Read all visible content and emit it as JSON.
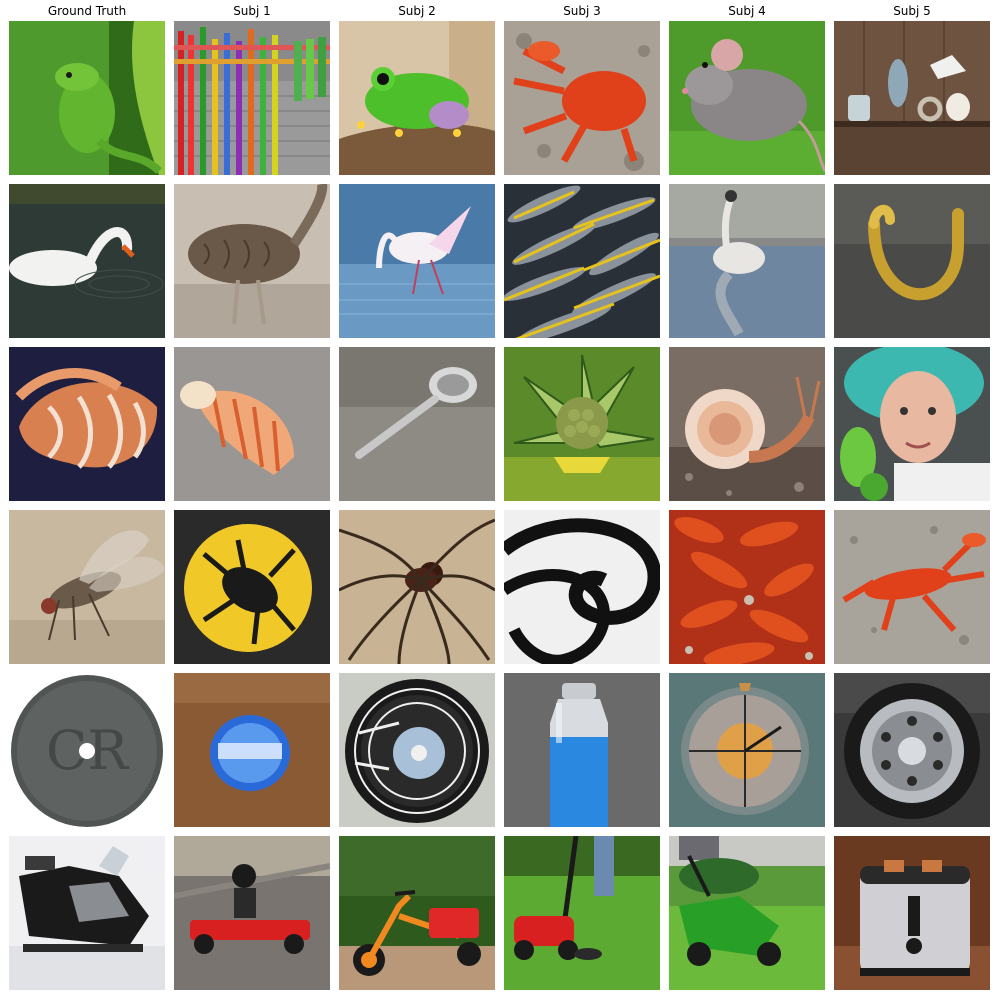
{
  "figure": {
    "columns": [
      {
        "title": "Ground Truth"
      },
      {
        "title": "Subj 1"
      },
      {
        "title": "Subj 2"
      },
      {
        "title": "Subj 3"
      },
      {
        "title": "Subj 4"
      },
      {
        "title": "Subj 5"
      }
    ],
    "rows": [
      {
        "images": [
          {
            "name": "green-lizard-image"
          },
          {
            "name": "colorful-fence-image"
          },
          {
            "name": "green-frog-image"
          },
          {
            "name": "red-crab-image"
          },
          {
            "name": "grey-mouse-image"
          },
          {
            "name": "shelf-with-objects-image"
          }
        ]
      },
      {
        "images": [
          {
            "name": "white-swan-image"
          },
          {
            "name": "brown-goose-image"
          },
          {
            "name": "white-bird-wading-image"
          },
          {
            "name": "pile-of-fish-image"
          },
          {
            "name": "goose-in-water-image"
          },
          {
            "name": "gold-hook-image"
          }
        ]
      },
      {
        "images": [
          {
            "name": "conch-shell-image"
          },
          {
            "name": "striped-shell-image"
          },
          {
            "name": "metal-spoon-image"
          },
          {
            "name": "green-plant-image"
          },
          {
            "name": "snail-image"
          },
          {
            "name": "old-woman-image"
          }
        ]
      },
      {
        "images": [
          {
            "name": "housefly-image"
          },
          {
            "name": "beetle-emblem-image"
          },
          {
            "name": "spider-image"
          },
          {
            "name": "black-swirl-image"
          },
          {
            "name": "crayfish-pile-image"
          },
          {
            "name": "red-lobster-image"
          }
        ]
      },
      {
        "images": [
          {
            "name": "old-coin-image"
          },
          {
            "name": "blue-bottle-cap-image"
          },
          {
            "name": "compact-disc-image"
          },
          {
            "name": "water-bottle-image"
          },
          {
            "name": "clock-face-image"
          },
          {
            "name": "wheel-image"
          }
        ]
      },
      {
        "images": [
          {
            "name": "snowmobile-image"
          },
          {
            "name": "go-kart-image"
          },
          {
            "name": "tricycle-image"
          },
          {
            "name": "lawn-mower-image"
          },
          {
            "name": "green-mower-image"
          },
          {
            "name": "toaster-image"
          }
        ]
      }
    ]
  }
}
